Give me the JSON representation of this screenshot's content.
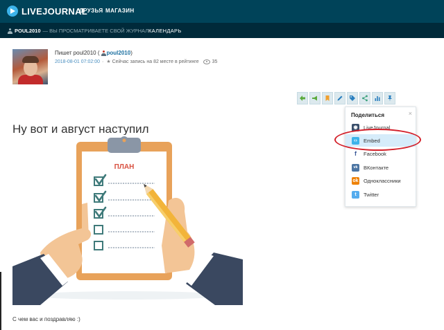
{
  "header": {
    "logo": "LIVEJOURNAL",
    "nav": [
      "ДРУЗЬЯ",
      "МАГАЗИН"
    ]
  },
  "subbar": {
    "user": "POUL2010",
    "note": "— ВЫ ПРОСМАТРИВАЕТЕ СВОЙ ЖУРНАЛ",
    "calendar": "КАЛЕНДАРЬ"
  },
  "post": {
    "byline_prefix": "Пишет poul2010 (",
    "author": "poul2010",
    "byline_suffix": ")",
    "date": "2018-08-01 07:02:00",
    "separator": "·",
    "rating": "Сейчас запись на 82 месте в рейтинге",
    "views": "35",
    "title": "Ну вот и август наступил",
    "image_label": "ПЛАН",
    "footer": "С чем вас и поздравляю :)"
  },
  "share": {
    "title": "Поделиться",
    "close": "×",
    "items": [
      {
        "label": "LiveJournal",
        "icon": "livejournal-icon",
        "color": "#3a4f6b"
      },
      {
        "label": "Embed",
        "icon": "embed-icon",
        "color": "#3db3ea"
      },
      {
        "label": "Facebook",
        "icon": "facebook-icon",
        "color": "#3b5998"
      },
      {
        "label": "ВКонтакте",
        "icon": "vk-icon",
        "color": "#4c75a3"
      },
      {
        "label": "Одноклассники",
        "icon": "odnoklassniki-icon",
        "color": "#ee8208"
      },
      {
        "label": "Twitter",
        "icon": "twitter-icon",
        "color": "#55acee"
      }
    ]
  },
  "toolbar_icons": [
    "back-icon",
    "megaphone-icon",
    "bookmark-icon",
    "edit-icon",
    "tag-icon",
    "share-icon",
    "stats-icon",
    "pin-icon"
  ],
  "colors": {
    "header": "#004359",
    "subheader": "#002a3a",
    "accent": "#3db3ea",
    "oval": "#d3202a"
  }
}
